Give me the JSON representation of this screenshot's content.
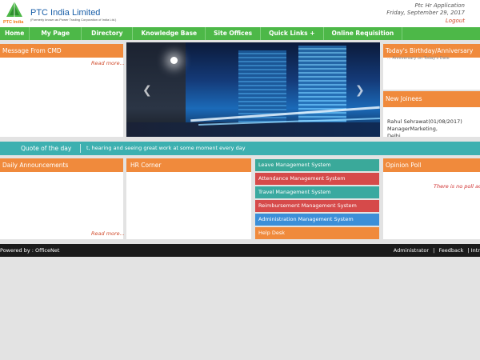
{
  "header": {
    "brand_name": "PTC India Limited",
    "brand_sub": "(Formerly known as Power Trading Corporation of India Ltd.)",
    "logo_text": "PTC India",
    "app_name": "Ptc Hr Application",
    "date": "Friday, September 29, 2017",
    "logout_label": "Logout"
  },
  "nav": {
    "items": [
      "Home",
      "My Page",
      "Directory",
      "Knowledge Base",
      "Site Offices",
      "Quick Links +",
      "Online Requisition"
    ]
  },
  "panels": {
    "cmd_title": "Message From CMD",
    "cmd_readmore": "Read more...",
    "bday_title": "Today's Birthday/Anniversary",
    "bday_text": "... Anniversary on Today's Date",
    "joinees_title": "New Joinees",
    "joinee_line1": "Rahul Sehrawat(01/08/2017)",
    "joinee_line2": "ManagerMarketing,",
    "joinee_line3": "Delhi",
    "announce_title": "Daily Announcements",
    "announce_readmore": "Read more...",
    "hr_title": "HR Corner",
    "poll_title": "Opinion Poll",
    "poll_text": "There is no poll acti"
  },
  "quote": {
    "title": "Quote of the day",
    "text": "t, hearing and seeing great work at some moment every day"
  },
  "systems": [
    {
      "label": "Leave Management System",
      "color": "#3aa99a"
    },
    {
      "label": "Attendance Management System",
      "color": "#d64a4a"
    },
    {
      "label": "Travel Management System",
      "color": "#3aa9a0"
    },
    {
      "label": "Reimbursement Management System",
      "color": "#d64a4a"
    },
    {
      "label": "Administration Management System",
      "color": "#3c8fd8"
    },
    {
      "label": "Help Desk",
      "color": "#f08a3c"
    }
  ],
  "footer": {
    "powered": "Powered by : OfficeNet",
    "admin": "Administrator",
    "feedback": "Feedback",
    "intranet": "Intr"
  },
  "colors": {
    "nav_green": "#4db848",
    "panel_orange": "#f08a3c",
    "quote_teal": "#3db0b0",
    "footer_black": "#1b1b1b"
  }
}
